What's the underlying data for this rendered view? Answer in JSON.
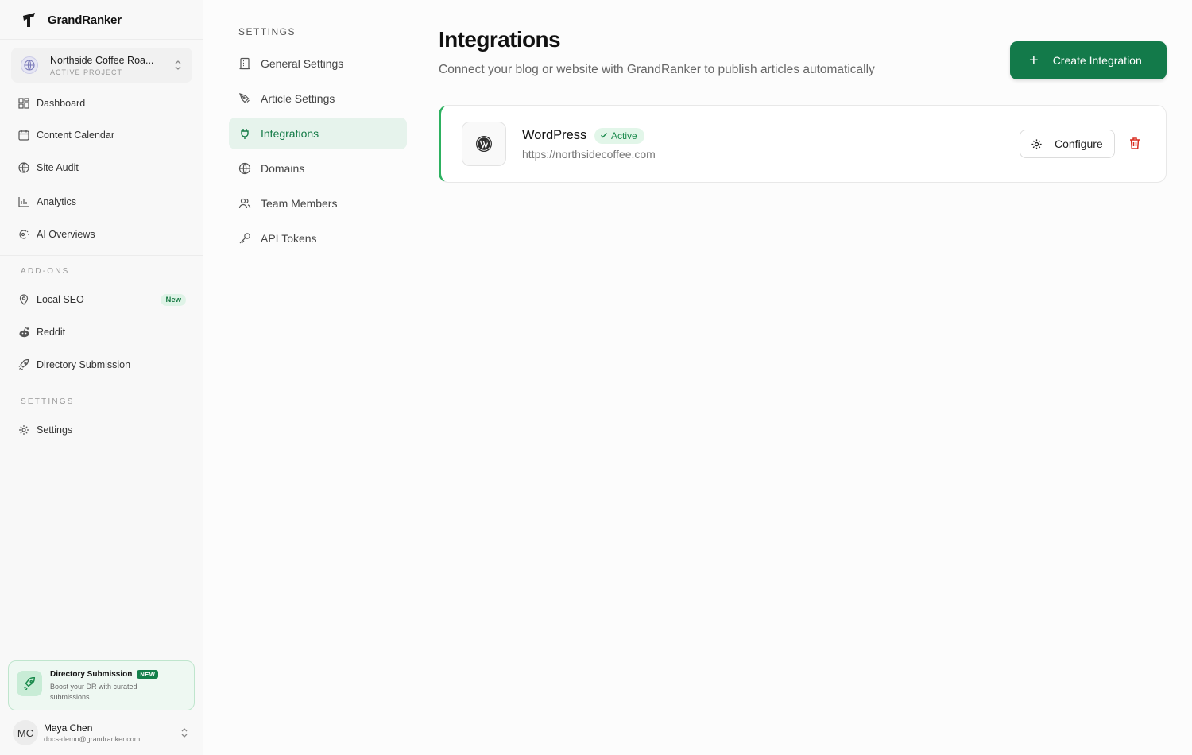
{
  "app": {
    "name": "GrandRanker"
  },
  "project": {
    "name": "Northside Coffee Roa...",
    "label": "ACTIVE PROJECT"
  },
  "sidebar": {
    "main_items": [
      {
        "label": "Dashboard",
        "icon": "dashboard-icon"
      },
      {
        "label": "Content Calendar",
        "icon": "calendar-icon"
      },
      {
        "label": "Site Audit",
        "icon": "globe-icon"
      },
      {
        "label": "Analytics",
        "icon": "bar-chart-icon"
      },
      {
        "label": "AI Overviews",
        "icon": "ai-overviews-icon"
      }
    ],
    "addons_heading": "ADD-ONS",
    "addon_items": [
      {
        "label": "Local SEO",
        "icon": "map-pin-icon",
        "badge": "New"
      },
      {
        "label": "Reddit",
        "icon": "reddit-icon"
      },
      {
        "label": "Directory Submission",
        "icon": "rocket-icon"
      }
    ],
    "settings_heading": "SETTINGS",
    "settings_items": [
      {
        "label": "Settings",
        "icon": "gear-icon"
      }
    ]
  },
  "promo": {
    "title": "Directory Submission",
    "badge": "NEW",
    "description": "Boost your DR with curated submissions"
  },
  "user": {
    "initials": "MC",
    "name": "Maya Chen",
    "email": "docs-demo@grandranker.com"
  },
  "settings_nav": {
    "heading": "SETTINGS",
    "items": [
      {
        "label": "General Settings",
        "icon": "building-icon"
      },
      {
        "label": "Article Settings",
        "icon": "pen-icon"
      },
      {
        "label": "Integrations",
        "icon": "plug-icon",
        "active": true
      },
      {
        "label": "Domains",
        "icon": "globe-icon"
      },
      {
        "label": "Team Members",
        "icon": "users-icon"
      },
      {
        "label": "API Tokens",
        "icon": "key-icon"
      }
    ]
  },
  "main": {
    "title": "Integrations",
    "subtitle": "Connect your blog or website with GrandRanker to publish articles automatically",
    "create_button": "Create Integration",
    "integrations": [
      {
        "name": "WordPress",
        "status": "Active",
        "url": "https://northsidecoffee.com",
        "configure_label": "Configure"
      }
    ]
  },
  "colors": {
    "accent": "#137a4a",
    "active_nav_bg": "#e6f3ec",
    "status_bg": "#e2f6e9",
    "delete": "#d92d20"
  }
}
